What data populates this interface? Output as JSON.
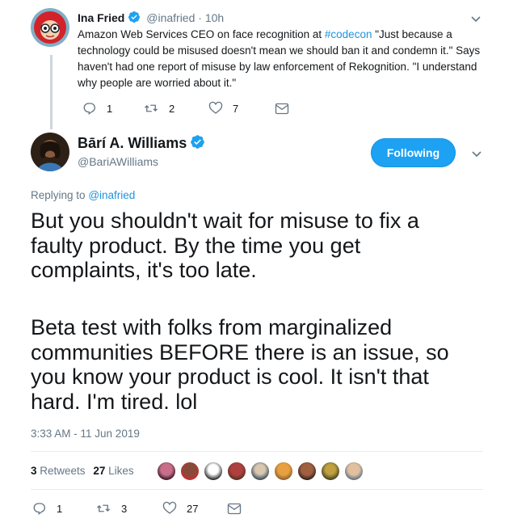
{
  "parent_tweet": {
    "name": "Ina Fried",
    "handle": "@inafried",
    "separator": "·",
    "time": "10h",
    "text_before_hashtag": "Amazon Web Services CEO on face recognition at ",
    "hashtag": "#codecon",
    "text_after_hashtag": " \"Just because a technology could be misused doesn't mean we should ban it and condemn it.\" Says haven't had one report of misuse by law enforcement of Rekognition. \"I understand why people are worried about it.\"",
    "replies": "1",
    "retweets": "2",
    "likes": "7"
  },
  "main_tweet": {
    "name": "Bārí A. Williams",
    "handle": "@BariAWilliams",
    "follow_label": "Following",
    "replying_label": "Replying to",
    "replying_handle": "@inafried",
    "paragraph1": "But you shouldn't wait for misuse to fix a faulty product. By the time you get complaints, it's too late.",
    "paragraph2": "Beta test with folks from marginalized communities BEFORE there is an issue, so you know your product is cool. It isn't that hard. I'm tired.  lol",
    "timestamp": "3:33 AM - 11 Jun 2019",
    "retweet_count": "3",
    "retweet_label": "Retweets",
    "like_count": "27",
    "like_label": "Likes",
    "replies": "1",
    "retweets": "3",
    "likes": "27"
  },
  "colors": {
    "accent": "#1da1f2",
    "link": "#1b95e0",
    "muted": "#657786",
    "text": "#14171a"
  },
  "icons": [
    "verified-badge-icon",
    "chevron-down-icon",
    "reply-icon",
    "retweet-icon",
    "heart-icon",
    "message-icon"
  ]
}
